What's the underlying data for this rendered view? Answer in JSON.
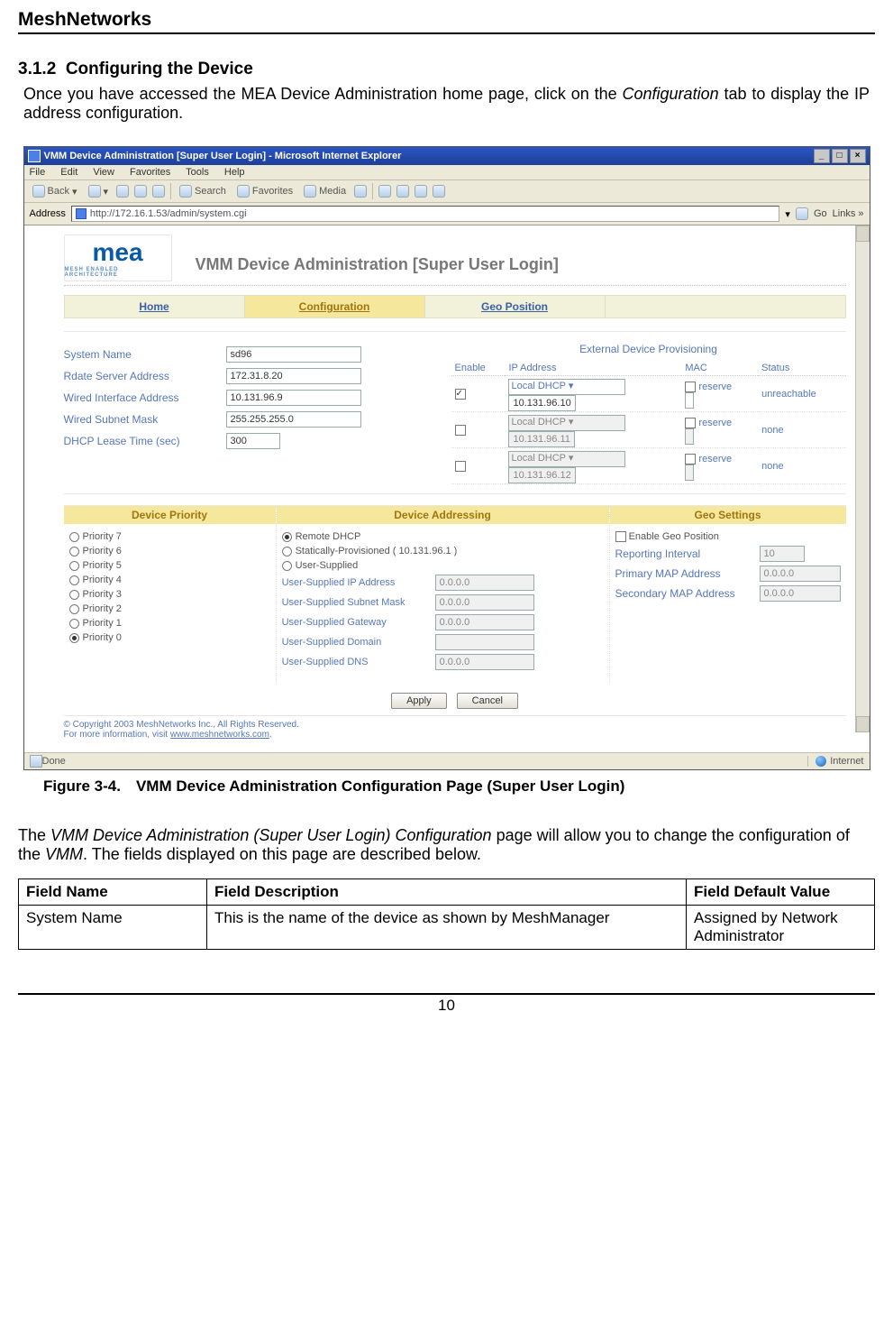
{
  "doc": {
    "header": "MeshNetworks",
    "section_no": "3.1.2",
    "section_title": "Configuring the Device",
    "intro_a": "Once you have accessed the MEA Device Administration home page, click on the ",
    "intro_em": "Configuration",
    "intro_b": " tab to display the IP address configuration.",
    "figure_caption": "Figure 3-4. VMM Device Administration Configuration Page (Super User Login)",
    "para2_a": "The ",
    "para2_em": "VMM Device Administration (Super User Login) Configuration",
    "para2_b": " page will allow you to change the configuration of the ",
    "para2_em2": "VMM",
    "para2_c": ". The fields displayed on this page are described below.",
    "page_number": "10"
  },
  "table": {
    "headers": [
      "Field Name",
      "Field Description",
      "Field Default Value"
    ],
    "rows": [
      {
        "name": "System Name",
        "desc": "This is the name of the device as shown by MeshManager",
        "default": "Assigned by Network Administrator"
      }
    ]
  },
  "ie": {
    "title": "VMM Device Administration [Super User Login] - Microsoft Internet Explorer",
    "menus": [
      "File",
      "Edit",
      "View",
      "Favorites",
      "Tools",
      "Help"
    ],
    "toolbar": {
      "back": "Back",
      "search": "Search",
      "favorites": "Favorites",
      "media": "Media"
    },
    "addr_label": "Address",
    "url": "http://172.16.1.53/admin/system.cgi",
    "go": "Go",
    "links": "Links »",
    "status_done": "Done",
    "status_zone": "Internet"
  },
  "app": {
    "logo_text": "mea",
    "logo_sub": "MESH ENABLED ARCHITECTURE",
    "title": "VMM Device Administration [Super User Login]",
    "tabs": [
      "Home",
      "Configuration",
      "Geo Position"
    ],
    "left_fields": {
      "system_name_lbl": "System Name",
      "system_name_val": "sd96",
      "rdate_lbl": "Rdate Server Address",
      "rdate_val": "172.31.8.20",
      "wired_if_lbl": "Wired Interface Address",
      "wired_if_val": "10.131.96.9",
      "wired_mask_lbl": "Wired Subnet Mask",
      "wired_mask_val": "255.255.255.0",
      "dhcp_lease_lbl": "DHCP Lease Time (sec)",
      "dhcp_lease_val": "300"
    },
    "ext": {
      "title": "External Device Provisioning",
      "cols": [
        "Enable",
        "IP Address",
        "MAC",
        "Status"
      ],
      "rows": [
        {
          "enabled": true,
          "mode": "Local DHCP",
          "ip": "10.131.96.10",
          "mac_reserve": "reserve",
          "status": "unreachable",
          "disabled": false
        },
        {
          "enabled": false,
          "mode": "Local DHCP",
          "ip": "10.131.96.11",
          "mac_reserve": "reserve",
          "status": "none",
          "disabled": true
        },
        {
          "enabled": false,
          "mode": "Local DHCP",
          "ip": "10.131.96.12",
          "mac_reserve": "reserve",
          "status": "none",
          "disabled": true
        }
      ]
    },
    "priorities": {
      "title": "Device Priority",
      "items": [
        "Priority 7",
        "Priority 6",
        "Priority 5",
        "Priority 4",
        "Priority 3",
        "Priority 2",
        "Priority 1",
        "Priority 0"
      ],
      "selected": 7
    },
    "addressing": {
      "title": "Device Addressing",
      "modes": [
        "Remote DHCP",
        "Statically-Provisioned ( 10.131.96.1 )",
        "User-Supplied"
      ],
      "selected": 0,
      "us_ip_lbl": "User-Supplied IP Address",
      "us_ip_val": "0.0.0.0",
      "us_mask_lbl": "User-Supplied Subnet Mask",
      "us_mask_val": "0.0.0.0",
      "us_gw_lbl": "User-Supplied Gateway",
      "us_gw_val": "0.0.0.0",
      "us_dom_lbl": "User-Supplied Domain",
      "us_dom_val": "",
      "us_dns_lbl": "User-Supplied DNS",
      "us_dns_val": "0.0.0.0"
    },
    "geo": {
      "title": "Geo Settings",
      "enable_lbl": "Enable Geo Position",
      "rep_lbl": "Reporting Interval",
      "rep_val": "10",
      "pri_lbl": "Primary MAP Address",
      "pri_val": "0.0.0.0",
      "sec_lbl": "Secondary MAP Address",
      "sec_val": "0.0.0.0"
    },
    "btn_apply": "Apply",
    "btn_cancel": "Cancel",
    "copyright_a": "© Copyright 2003 MeshNetworks Inc., All Rights Reserved.",
    "copyright_b": "For more information, visit ",
    "copyright_link": "www.meshnetworks.com"
  }
}
